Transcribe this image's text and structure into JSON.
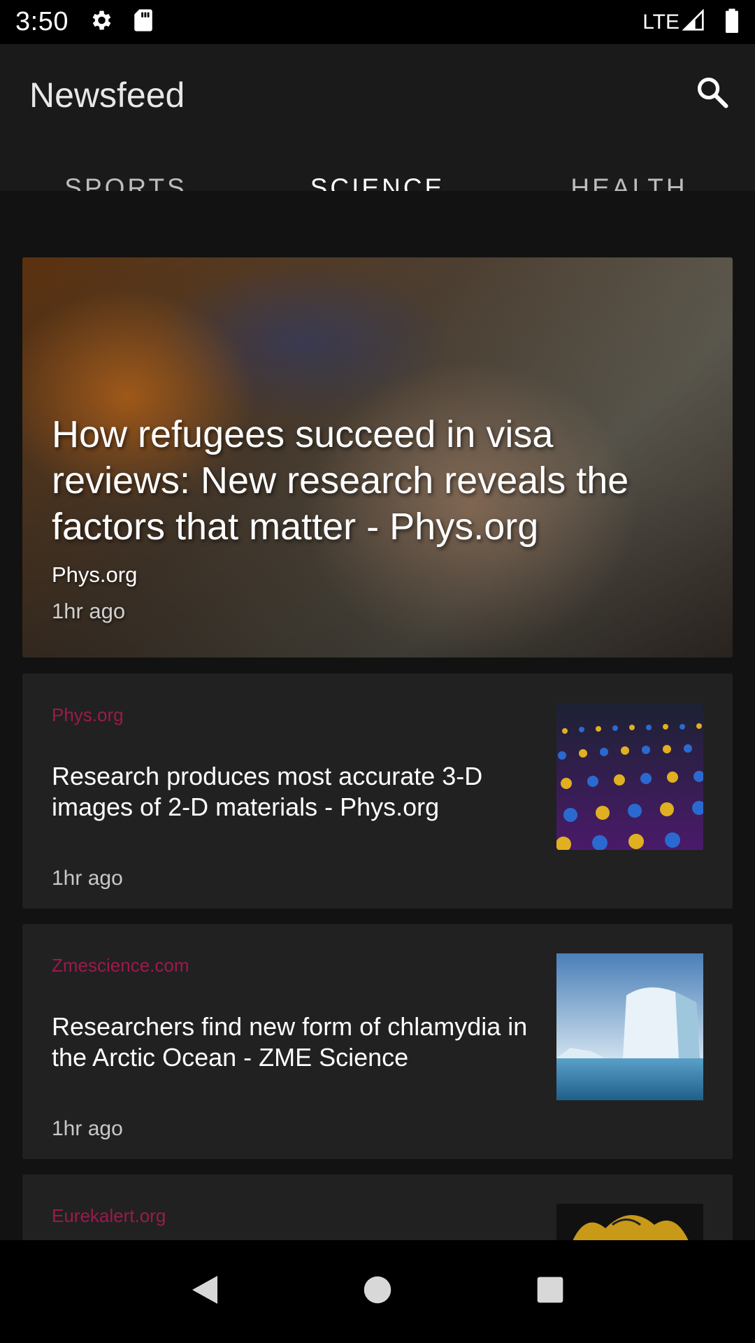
{
  "status_bar": {
    "time": "3:50",
    "network": "LTE",
    "icons": [
      "settings-icon",
      "sd-card-icon",
      "signal-icon",
      "battery-icon"
    ]
  },
  "app_bar": {
    "title": "Newsfeed",
    "search_icon": "search-icon"
  },
  "tabs": [
    {
      "label": "SPORTS",
      "active": false
    },
    {
      "label": "SCIENCE",
      "active": true
    },
    {
      "label": "HEALTH",
      "active": false
    }
  ],
  "hero": {
    "title": "How refugees succeed in visa reviews: New research reveals the factors that matter - Phys.org",
    "source": "Phys.org",
    "time": "1hr ago"
  },
  "articles": [
    {
      "source": "Phys.org",
      "title": "Research produces most accurate 3-D images of 2-D materials - Phys.org",
      "time": "1hr ago",
      "thumb": "lattice-image"
    },
    {
      "source": "Zmescience.com",
      "title": "Researchers find new form of chlamydia in the Arctic Ocean - ZME Science",
      "time": "1hr ago",
      "thumb": "iceberg-image"
    },
    {
      "source": "Eurekalert.org",
      "title": "",
      "time": "",
      "thumb": "yellow-shape-image"
    }
  ],
  "colors": {
    "accent": "#b0174f",
    "source_text": "#9c1a4c",
    "card_bg": "#212121",
    "app_bar_bg": "#1a1a1a"
  },
  "nav_bar": {
    "icons": [
      "back-icon",
      "home-icon",
      "recents-icon"
    ]
  }
}
